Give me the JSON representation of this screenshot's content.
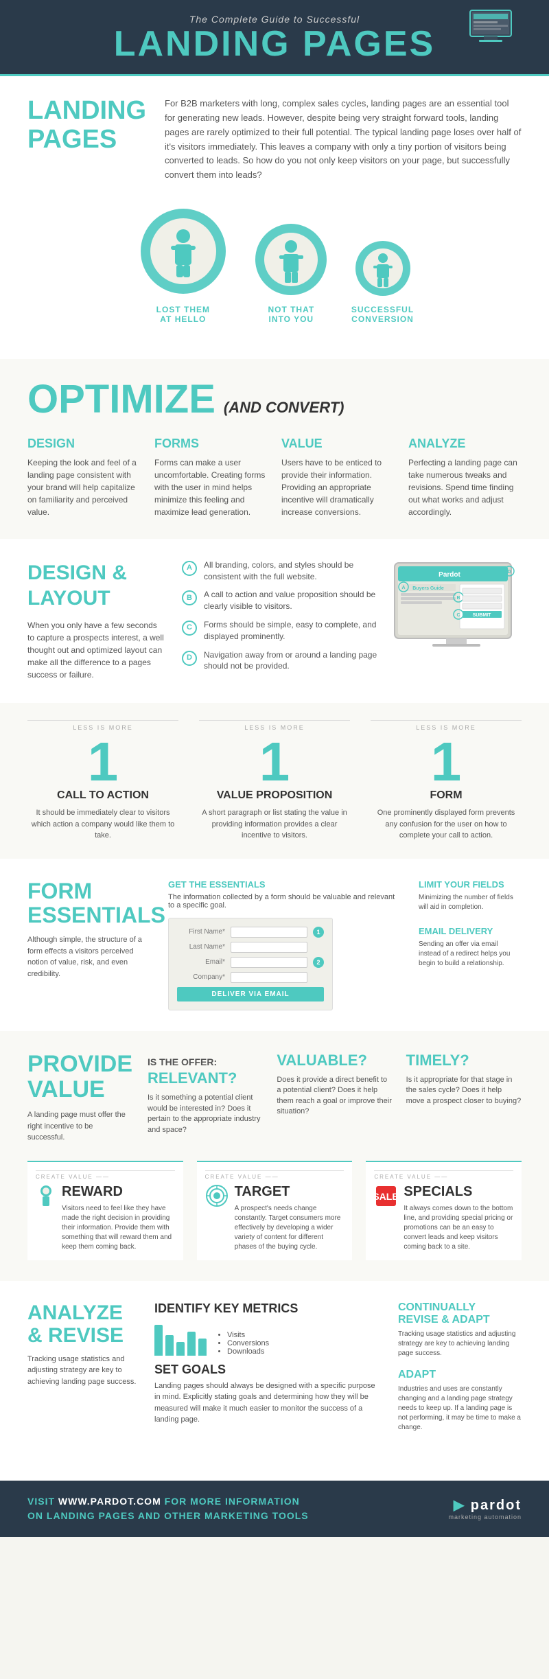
{
  "header": {
    "subtitle": "The Complete Guide to Successful",
    "title_teal": "LANDING PAGES"
  },
  "landing": {
    "title": "LANDING PAGES",
    "text": "For B2B marketers with long, complex sales cycles, landing pages are an essential tool for generating new leads. However, despite being very straight forward tools, landing pages are rarely optimized to their full potential. The typical landing page loses over half of it's visitors immediately. This leaves a company with only a tiny portion of visitors being converted to leads. So how do you not only keep visitors on your page, but successfully convert them into leads?",
    "funnel": [
      {
        "label": "LOST THEM AT HELLO",
        "size": "large",
        "fill": 65
      },
      {
        "label": "NOT THAT INTO YOU",
        "size": "medium",
        "fill": 30
      },
      {
        "label": "SUCCESSFUL CONVERSION",
        "size": "small",
        "fill": 10
      }
    ]
  },
  "optimize": {
    "word": "OPTIMIZE",
    "subtext": "(AND CONVERT)",
    "cols": [
      {
        "title": "DESIGN",
        "text": "Keeping the look and feel of a landing page consistent with your brand will help capitalize on familiarity and perceived value."
      },
      {
        "title": "FORMS",
        "text": "Forms can make a user uncomfortable. Creating forms with the user in mind helps minimize this feeling and maximize lead generation."
      },
      {
        "title": "VALUE",
        "text": "Users have to be enticed to provide their information. Providing an appropriate incentive will dramatically increase conversions."
      },
      {
        "title": "ANALYZE",
        "text": "Perfecting a landing page can take numerous tweaks and revisions. Spend time finding out what works and adjust accordingly."
      }
    ]
  },
  "design": {
    "title": "DESIGN &",
    "title2": "LAYOUT",
    "desc": "When you only have a few seconds to capture a prospects interest, a well thought out and optimized layout can make all the difference to a pages success or failure.",
    "points": [
      {
        "letter": "A",
        "text": "All branding, colors, and styles should be consistent with the full website."
      },
      {
        "letter": "B",
        "text": "A call to action and value proposition should be clearly visible to visitors."
      },
      {
        "letter": "C",
        "text": "Forms should be simple, easy to complete, and displayed prominently."
      },
      {
        "letter": "D",
        "text": "Navigation away from or around a landing page should not be provided."
      }
    ]
  },
  "cta": {
    "cols": [
      {
        "number": "1",
        "title": "CALL TO ACTION",
        "text": "It should be immediately clear to visitors which action a company would like them to take.",
        "less_more": "LESS IS MORE"
      },
      {
        "number": "1",
        "title": "VALUE PROPOSITION",
        "text": "A short paragraph or list stating the value in providing information provides a clear incentive to visitors.",
        "less_more": "LESS IS MORE"
      },
      {
        "number": "1",
        "title": "FORM",
        "text": "One prominently displayed form prevents any confusion for the user on how to complete your call to action.",
        "less_more": "LESS IS MORE"
      }
    ]
  },
  "forms": {
    "title": "FORM",
    "title2": "ESSENTIALS",
    "desc": "Although simple, the structure of a form effects a visitors perceived notion of value, risk, and even credibility.",
    "get_title": "GET THE ESSENTIALS",
    "get_desc": "The information collected by a form should be valuable and relevant to a specific goal.",
    "fields": [
      {
        "label": "First Name*",
        "number": "1"
      },
      {
        "label": "Last Name*",
        "number": ""
      },
      {
        "label": "Email*",
        "number": "2"
      },
      {
        "label": "Company*",
        "number": ""
      }
    ],
    "submit": "DELIVER VIA EMAIL",
    "limit": {
      "title": "LIMIT YOUR FIELDS",
      "text": "Minimizing the number of fields will aid in completion."
    },
    "email": {
      "title": "EMAIL DELIVERY",
      "text": "Sending an offer via email instead of a redirect helps you begin to build a relationship."
    }
  },
  "value": {
    "title": "PROVIDE VALUE",
    "desc": "A landing page must offer the right incentive to be successful.",
    "questions": [
      {
        "q1": "IS THE OFFER:",
        "q2": "RELEVANT?",
        "text": "Is it something a potential client would be interested in? Does it pertain to the appropriate industry and space?"
      },
      {
        "q1": "",
        "q2": "VALUABLE?",
        "text": "Does it provide a direct benefit to a potential client? Does it help them reach a goal or improve their situation?"
      },
      {
        "q1": "",
        "q2": "TIMELY?",
        "text": "Is it appropriate for that stage in the sales cycle? Does it help move a prospect closer to buying?"
      }
    ],
    "create_value": [
      {
        "title": "REWARD",
        "text": "Visitors need to feel like they have made the right decision in providing their information. Provide them with something that will reward them and keep them coming back."
      },
      {
        "title": "TARGET",
        "text": "A prospect's needs change constantly. Target consumers more effectively by developing a wider variety of content for different phases of the buying cycle."
      },
      {
        "title": "SPECIALS",
        "text": "It always comes down to the bottom line, and providing special pricing or promotions can be an easy to convert leads and keep visitors coming back to a site."
      }
    ]
  },
  "analyze": {
    "title": "ANALYZE & REVISE",
    "desc": "Tracking usage statistics and adjusting strategy are key to achieving landing page success.",
    "metrics_title": "IDENTIFY KEY METRICS",
    "metrics_list": [
      "Visits",
      "Conversions",
      "Downloads"
    ],
    "set_goals_title": "SET GOALS",
    "set_goals_text": "Landing pages should always be designed with a specific purpose in mind. Explicitly stating goals and determining how they will be measured will make it much easier to monitor the success of a landing page.",
    "right": [
      {
        "title": "CONTINUALLY REVISE & ADAPT",
        "text": ""
      },
      {
        "title": "ADAPT",
        "text": "Industries and uses are constantly changing and a landing page strategy needs to keep up. If a landing page is not performing, it may be time to make a change."
      }
    ],
    "continually_text": "Tracking usage statistics and adjusting strategy are key to achieving landing page success."
  },
  "footer": {
    "line1": "VISIT WWW.PARDOT.COM FOR MORE INFORMATION",
    "line2": "ON LANDING PAGES AND OTHER MARKETING TOOLS",
    "logo": "pardot"
  }
}
